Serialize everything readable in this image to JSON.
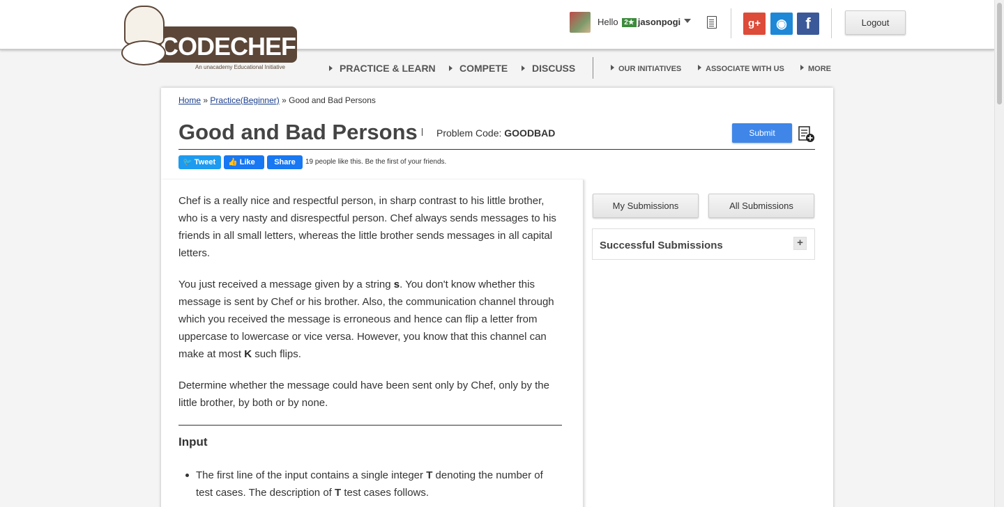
{
  "header": {
    "logo_text": "CODECHEF",
    "logo_sub": "An unacademy Educational Initiative",
    "hello": "Hello",
    "star_rating": "2★",
    "username": "jasonpogi",
    "logout_label": "Logout"
  },
  "social": {
    "gplus": "g+",
    "github": "◉",
    "facebook": "f"
  },
  "nav": {
    "practice": "PRACTICE & LEARN",
    "compete": "COMPETE",
    "discuss": "DISCUSS",
    "initiatives": "OUR INITIATIVES",
    "associate": "ASSOCIATE WITH US",
    "more": "MORE"
  },
  "breadcrumb": {
    "home": "Home",
    "sep": "»",
    "practice": "Practice(Beginner)",
    "current": "Good and Bad Persons"
  },
  "problem": {
    "title": "Good and Bad Persons",
    "code_label": "Problem Code:",
    "code": "GOODBAD",
    "submit_label": "Submit"
  },
  "share": {
    "tweet": "Tweet",
    "like": "Like",
    "share": "Share",
    "like_text": "19 people like this. Be the first of your friends."
  },
  "statement": {
    "p1": "Chef is a really nice and respectful person, in sharp contrast to his little brother, who is a very nasty and disrespectful person. Chef always sends messages to his friends in all small letters, whereas the little brother sends messages in all capital letters.",
    "p2_a": "You just received a message given by a string ",
    "p2_s": "s",
    "p2_b": ". You don't know whether this message is sent by Chef or his brother. Also, the communication channel through which you received the message is erroneous and hence can flip a letter from uppercase to lowercase or vice versa. However, you know that this channel can make at most ",
    "p2_k": "K",
    "p2_c": " such flips.",
    "p3": "Determine whether the message could have been sent only by Chef, only by the little brother, by both or by none.",
    "input_heading": "Input",
    "bullet1_a": "The first line of the input contains a single integer ",
    "bullet1_t": "T",
    "bullet1_b": " denoting the number of test cases. The description of ",
    "bullet1_t2": "T",
    "bullet1_c": " test cases follows."
  },
  "sidebar": {
    "my_submissions": "My Submissions",
    "all_submissions": "All Submissions",
    "successful_submissions": "Successful Submissions",
    "expand": "+"
  },
  "colors": {
    "submit_blue": "#3f86e8",
    "logo_brown": "#5b4638",
    "gplus_red": "#dd4b39",
    "github_blue": "#1e88d6",
    "facebook_blue": "#3b5998"
  }
}
